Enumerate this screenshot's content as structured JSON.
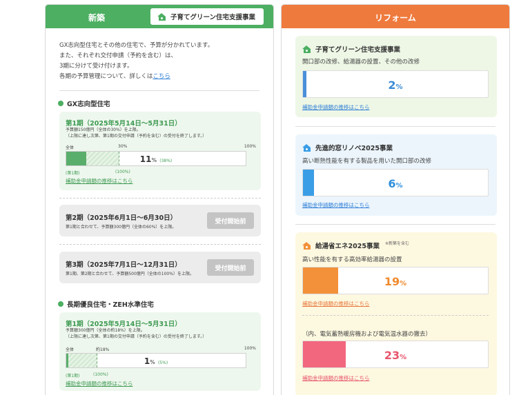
{
  "left": {
    "header_title": "新築",
    "badge_label": "子育てグリーン住宅支援事業",
    "intro_lines": [
      "GX志向型住宅とその他の住宅で、予算が分かれています。",
      "また、それぞれ交付申請（予約を含む）は、",
      "3期に分けて受け付けます。"
    ],
    "intro_last": "各期の予算管理について、詳しくは",
    "intro_link": "こちら",
    "sections": [
      {
        "title": "GX志向型住宅",
        "period1": {
          "heading": "第1期（2025年5月14日～5月31日）",
          "note1": "予算額150億円（全体の30%）を上限。",
          "note2": "（上限に達し次第、第1期の交付申請（予約を含む）の受付を終了します。）",
          "label_left": "全体",
          "label_mid": "30%",
          "label_right": "100%",
          "progress_value": 11,
          "progress_unit": "%",
          "progress_sub": "(38%)",
          "sub_left": "(第1期)",
          "sub_mid": "(100%)",
          "link": "補助金申請額の推移はこちら"
        },
        "period2": {
          "heading": "第2期（2025年6月1日～6月30日）",
          "note": "第1期と合わせて、予算額300億円（全体の60%）を上限。",
          "button": "受付開始前"
        },
        "period3": {
          "heading": "第3期（2025年7月1日～12月31日）",
          "note": "第1期、第2期と合わせて、予算額500億円（全体の100%）を上限。",
          "button": "受付開始前"
        }
      },
      {
        "title": "長期優良住宅・ZEH水準住宅",
        "period1": {
          "heading": "第1期（2025年5月14日～5月31日）",
          "note1": "予算額300億円（全体の約18%）を上限。",
          "note2": "（上限に達し次第、第1期の交付申請（予約を含む）の受付を終了します。）",
          "label_left": "全体",
          "label_mid": "約18%",
          "label_right": "100%",
          "progress_value": 1,
          "progress_unit": "%",
          "progress_sub": "(5%)",
          "sub_left": "(第1期)",
          "sub_mid": "(100%)",
          "link": "補助金申請額の推移はこちら"
        }
      }
    ]
  },
  "right": {
    "header_title": "リフォーム",
    "cards": [
      {
        "title": "子育てグリーン住宅支援事業",
        "desc": "開口部の改修、給湯器の設置、その他の改修",
        "progress_value": 2,
        "progress_unit": "%",
        "link": "補助金申請額の推移はこちら",
        "accent": "#4a90d9"
      },
      {
        "title": "先進的窓リノベ2025事業",
        "desc": "高い断熱性能を有する製品を用いた開口部の改修",
        "progress_value": 6,
        "progress_unit": "%",
        "link": "補助金申請額の推移はこちら",
        "accent": "#3a9ee6"
      },
      {
        "title": "給湯省エネ2025事業",
        "note": "※新築を含む",
        "desc": "高い性能を有する高効率給湯器の設置",
        "progress_value": 19,
        "progress_unit": "%",
        "link": "補助金申請額の推移はこちら",
        "accent": "#f2913a"
      },
      {
        "desc": "（内、電気蓄熱暖房機および電気温水器の撤去）",
        "progress_value": 23,
        "progress_unit": "%",
        "link": "補助金申請額の推移はこちら",
        "accent": "#f2677e"
      }
    ]
  }
}
